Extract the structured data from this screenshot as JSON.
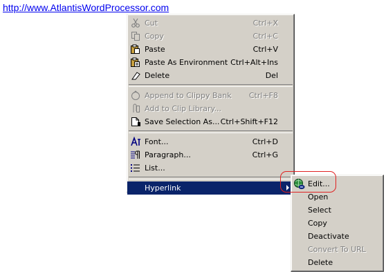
{
  "link": {
    "text": "http://www.AtlantisWordProcessor.com"
  },
  "context_menu": {
    "items": [
      {
        "label": "Cut",
        "shortcut": "Ctrl+X",
        "icon": "scissors-icon",
        "disabled": true
      },
      {
        "label": "Copy",
        "shortcut": "Ctrl+C",
        "icon": "copy-icon",
        "disabled": true
      },
      {
        "label": "Paste",
        "shortcut": "Ctrl+V",
        "icon": "paste-icon",
        "disabled": false
      },
      {
        "label": "Paste As Environment",
        "shortcut": "Ctrl+Alt+Ins",
        "icon": "paste-environment-icon",
        "disabled": false
      },
      {
        "label": "Delete",
        "shortcut": "Del",
        "icon": "eraser-icon",
        "disabled": false
      },
      {
        "label": "Append to Clippy Bank",
        "shortcut": "Ctrl+F8",
        "icon": "clippy-icon",
        "disabled": true
      },
      {
        "label": "Add to Clip Library...",
        "shortcut": "",
        "icon": "clip-library-icon",
        "disabled": true
      },
      {
        "label": "Save Selection As...",
        "shortcut": "Ctrl+Shift+F12",
        "icon": "save-selection-icon",
        "disabled": false
      },
      {
        "label": "Font...",
        "shortcut": "Ctrl+D",
        "icon": "font-icon",
        "disabled": false
      },
      {
        "label": "Paragraph...",
        "shortcut": "Ctrl+G",
        "icon": "paragraph-icon",
        "disabled": false
      },
      {
        "label": "List...",
        "shortcut": "",
        "icon": "list-icon",
        "disabled": false
      },
      {
        "label": "Hyperlink",
        "shortcut": "",
        "icon": "submenu-arrow-icon",
        "disabled": false
      }
    ]
  },
  "hyperlink_submenu": {
    "items": [
      {
        "label": "Edit...",
        "icon": "globe-link-icon",
        "disabled": false
      },
      {
        "label": "Open",
        "disabled": false
      },
      {
        "label": "Select",
        "disabled": false
      },
      {
        "label": "Copy",
        "disabled": false
      },
      {
        "label": "Deactivate",
        "disabled": false
      },
      {
        "label": "Convert To URL",
        "disabled": true
      },
      {
        "label": "Delete",
        "disabled": false
      }
    ]
  },
  "colors": {
    "menu_bg": "#d4d0c8",
    "highlight_bg": "#0a246a",
    "link": "#0000ee",
    "annotation_ring": "#e02020"
  }
}
